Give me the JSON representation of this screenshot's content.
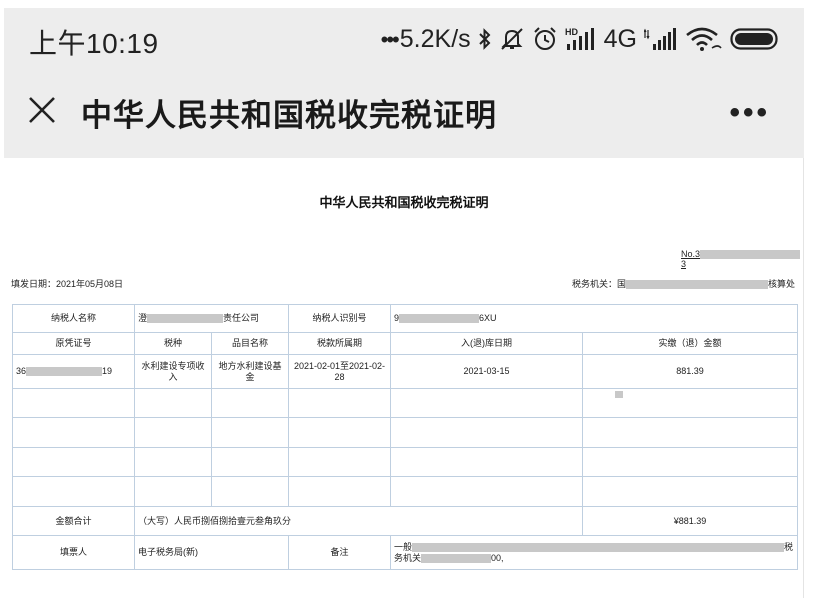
{
  "status_bar": {
    "time": "上午10:19",
    "net_speed": "5.2K/s",
    "network_type": "4G",
    "icons": [
      "bluetooth-icon",
      "mute-icon",
      "alarm-icon",
      "hd-signal-icon",
      "signal-icon",
      "wifi-icon",
      "battery-icon"
    ]
  },
  "nav": {
    "close_icon": "close-icon",
    "title": "中华人民共和国税收完税证明",
    "more_label": "•••"
  },
  "certificate": {
    "title": "中华人民共和国税收完税证明",
    "number_prefix": "No.3",
    "number_suffix": "3",
    "fill_date": "填发日期：2021年05月08日",
    "tax_office_prefix": "税务机关：国",
    "tax_office_suffix": "核算处",
    "taxpayer_name_label": "纳税人名称",
    "taxpayer_name_prefix": "澄",
    "taxpayer_name_suffix": "责任公司",
    "taxpayer_id_label": "纳税人识别号",
    "taxpayer_id_prefix": "9",
    "taxpayer_id_suffix": "6XU",
    "columns": [
      "原凭证号",
      "税种",
      "品目名称",
      "税款所属期",
      "入(退)库日期",
      "实缴（退）金额"
    ],
    "row": {
      "voucher_prefix": "36",
      "voucher_suffix": "19",
      "tax_type": "水利建设专项收入",
      "item_name": "地方水利建设基金",
      "period": "2021-02-01至2021-02-28",
      "date": "2021-03-15",
      "amount": "881.39"
    },
    "total_label": "金额合计",
    "total_in_words": "（大写）人民币捌佰捌拾壹元叁角玖分",
    "total_amount": "¥881.39",
    "issuer_label": "填票人",
    "issuer_value": "电子税务局(新)",
    "remark_label": "备注",
    "remark_line1_prefix": "一般",
    "remark_line1_suffix": "税",
    "remark_line2_prefix": "务机关",
    "remark_line2_suffix": "00,"
  }
}
